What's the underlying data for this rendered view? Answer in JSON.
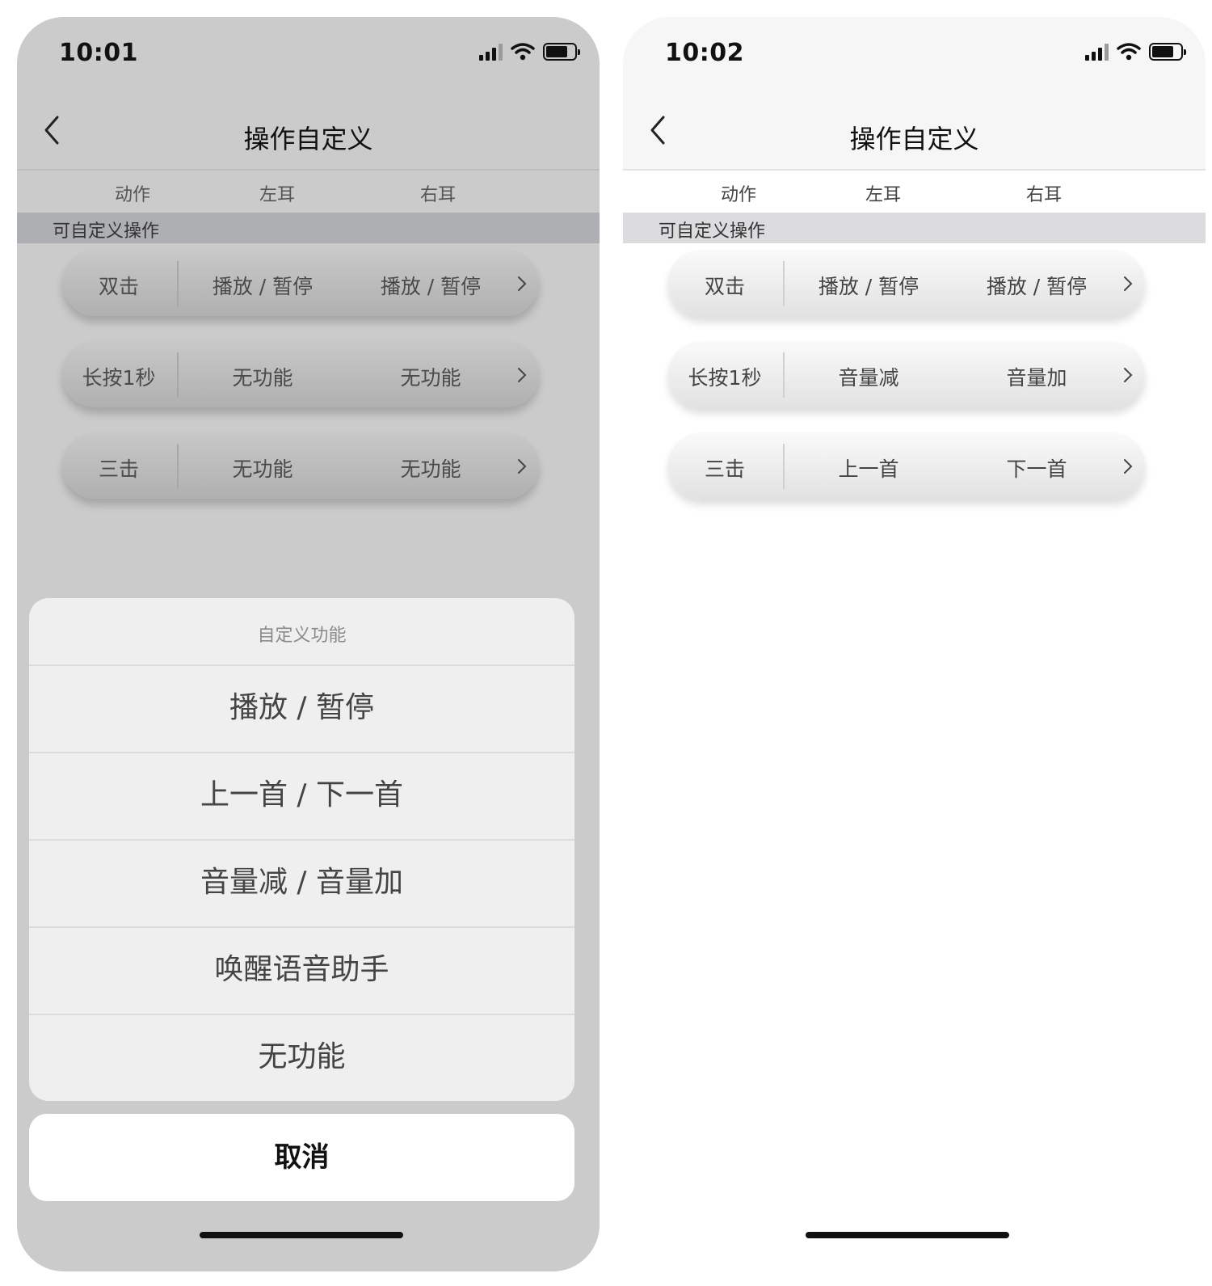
{
  "left_screen": {
    "status_time": "10:01",
    "nav_title": "操作自定义",
    "columns": {
      "action": "动作",
      "left": "左耳",
      "right": "右耳"
    },
    "section": "可自定义操作",
    "rows": [
      {
        "action": "双击",
        "left": "播放 / 暂停",
        "right": "播放 / 暂停"
      },
      {
        "action": "长按1秒",
        "left": "无功能",
        "right": "无功能"
      },
      {
        "action": "三击",
        "left": "无功能",
        "right": "无功能"
      }
    ],
    "sheet": {
      "title": "自定义功能",
      "options": [
        "播放 / 暂停",
        "上一首 / 下一首",
        "音量减 / 音量加",
        "唤醒语音助手",
        "无功能"
      ],
      "cancel": "取消"
    }
  },
  "right_screen": {
    "status_time": "10:02",
    "nav_title": "操作自定义",
    "columns": {
      "action": "动作",
      "left": "左耳",
      "right": "右耳"
    },
    "section": "可自定义操作",
    "rows": [
      {
        "action": "双击",
        "left": "播放 / 暂停",
        "right": "播放 / 暂停"
      },
      {
        "action": "长按1秒",
        "left": "音量减",
        "right": "音量加"
      },
      {
        "action": "三击",
        "left": "上一首",
        "right": "下一首"
      }
    ]
  }
}
